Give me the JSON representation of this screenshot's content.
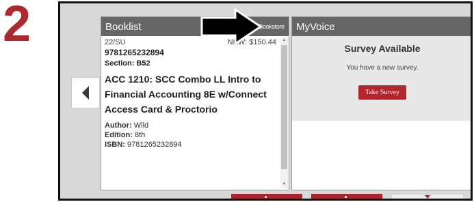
{
  "step_number": "2",
  "booklist": {
    "title": "Booklist",
    "link": "Bookstore",
    "term": "22/SU",
    "price": "NEW: $150.44",
    "isbn_main": "9781265232894",
    "section_label": "Section:",
    "section_value": "B52",
    "course_title": "ACC 1210: SCC Combo LL Intro to Financial Accounting 8E w/Connect Access Card & Proctorio",
    "author_label": "Author:",
    "author_value": "Wild",
    "edition_label": "Edition:",
    "edition_value": "8th",
    "isbn_label": "ISBN:",
    "isbn_value": "9781265232894"
  },
  "myvoice": {
    "title": "MyVoice",
    "survey_title": "Survey Available",
    "survey_text": "You have a new survey.",
    "survey_button": "Take Survey"
  },
  "colors": {
    "accent": "#b0282f",
    "header": "#666666",
    "panel_bg": "#e8e8e8"
  },
  "icons": {
    "nav": "chevron-left-icon",
    "pointer": "arrow-right-icon"
  }
}
